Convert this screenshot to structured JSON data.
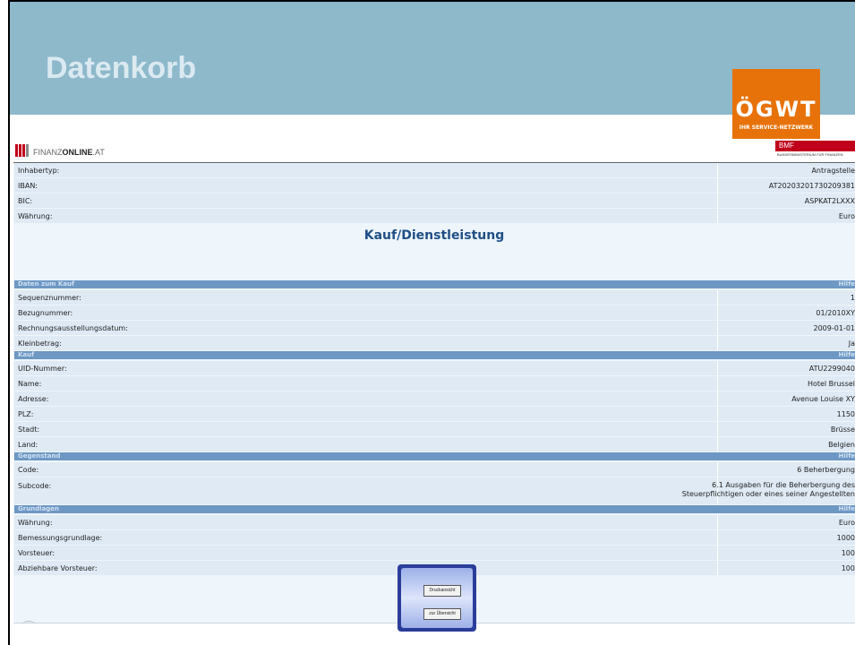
{
  "slide": {
    "title": "Datenkorb",
    "logo_text": "ÖGWT",
    "logo_subtext": "IHR SERVICE-NETZWERK"
  },
  "finanzonline": {
    "brand_light": "FINANZ",
    "brand_bold": "ONLINE",
    "brand_suffix": ".AT",
    "ministry_label": "BMF",
    "ministry_sub": "BUNDESMINISTERIUM FÜR FINANZEN"
  },
  "top_rows": [
    {
      "label": "Inhabertyp:",
      "value": "Antragstelle"
    },
    {
      "label": "IBAN:",
      "value": "AT20203201730209381"
    },
    {
      "label": "BIC:",
      "value": "ASPKAT2LXXX"
    },
    {
      "label": "Währung:",
      "value": "Euro"
    }
  ],
  "page_heading": "Kauf/Dienstleistung",
  "sections": [
    {
      "title": "Daten zum Kauf",
      "help": "Hilfe",
      "rows": [
        {
          "label": "Sequenznummer:",
          "value": "1"
        },
        {
          "label": "Bezugnummer:",
          "value": "01/2010XY"
        },
        {
          "label": "Rechnungsausstellungsdatum:",
          "value": "2009-01-01"
        },
        {
          "label": "Kleinbetrag:",
          "value": "Ja"
        }
      ]
    },
    {
      "title": "Kauf",
      "help": "Hilfe",
      "rows": [
        {
          "label": "UID-Nummer:",
          "value": "ATU2299040"
        },
        {
          "label": "Name:",
          "value": "Hotel Brussel"
        },
        {
          "label": "Adresse:",
          "value": "Avenue Louise XY"
        },
        {
          "label": "PLZ:",
          "value": "1150"
        },
        {
          "label": "Stadt:",
          "value": "Brüsse"
        },
        {
          "label": "Land:",
          "value": "Belgien"
        }
      ]
    },
    {
      "title": "Gegenstand",
      "help": "Hilfe",
      "rows": [
        {
          "label": "Code:",
          "value": "6 Beherbergung"
        },
        {
          "label": "Subcode:",
          "value": "6.1 Ausgaben für die Beherbergung des",
          "value2": "Steuerpflichtigen oder eines seiner Angestellten"
        }
      ]
    },
    {
      "title": "Grundlagen",
      "help": "Hilfe",
      "rows": [
        {
          "label": "Währung:",
          "value": "Euro"
        },
        {
          "label": "Bemessungsgrundlage:",
          "value": "1000"
        },
        {
          "label": "Vorsteuer:",
          "value": "100"
        },
        {
          "label": "Abziehbare Vorsteuer:",
          "value": "100"
        }
      ]
    }
  ],
  "buttons": {
    "print": "Druckansicht",
    "overview": "zur Übersicht"
  },
  "colors": {
    "header_bg": "#8db9cb",
    "logo_bg": "#e8720a",
    "section_bar": "#6e98c4",
    "row_bg": "#dfeaf5",
    "heading_blue": "#1f4f86"
  }
}
